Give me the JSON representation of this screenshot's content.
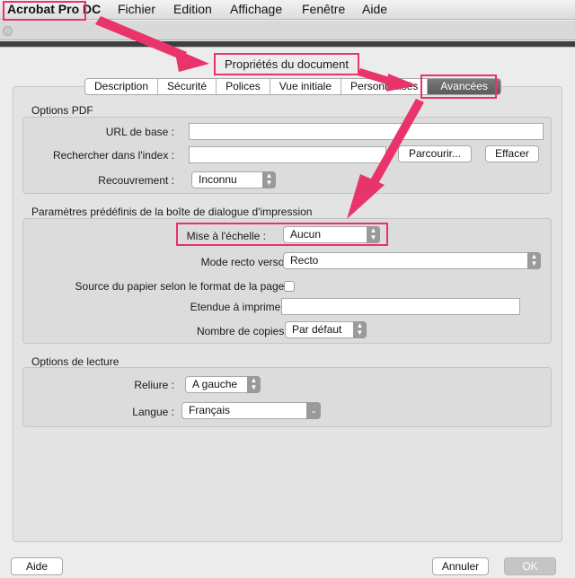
{
  "menubar": {
    "app_name": "Acrobat Pro DC",
    "items": [
      "Fichier",
      "Edition",
      "Affichage",
      "Fenêtre",
      "Aide"
    ]
  },
  "dialog": {
    "title": "Propriétés du document",
    "tabs": [
      "Description",
      "Sécurité",
      "Polices",
      "Vue initiale",
      "Personnalisés",
      "Avancées"
    ],
    "active_tab": "Avancées"
  },
  "pdf_options": {
    "title": "Options PDF",
    "base_url_label": "URL de base :",
    "base_url_value": "",
    "index_label": "Rechercher dans l'index :",
    "index_value": "",
    "browse_button": "Parcourir...",
    "clear_button": "Effacer",
    "trapping_label": "Recouvrement :",
    "trapping_value": "Inconnu"
  },
  "print_presets": {
    "title": "Paramètres prédéfinis de la boîte de dialogue d'impression",
    "scaling_label": "Mise à l'échelle :",
    "scaling_value": "Aucun",
    "duplex_label": "Mode recto verso :",
    "duplex_value": "Recto",
    "paper_source_label": "Source du papier selon le format de la page :",
    "paper_source_checked": false,
    "print_range_label": "Etendue à imprimer :",
    "print_range_value": "",
    "copies_label": "Nombre de copies :",
    "copies_value": "Par défaut"
  },
  "reading_options": {
    "title": "Options de lecture",
    "binding_label": "Reliure :",
    "binding_value": "A gauche",
    "language_label": "Langue :",
    "language_value": "Français"
  },
  "footer": {
    "help_button": "Aide",
    "cancel_button": "Annuler",
    "ok_button": "OK"
  },
  "colors": {
    "highlight": "#e8336b",
    "active_tab": "#5f5f5f"
  }
}
